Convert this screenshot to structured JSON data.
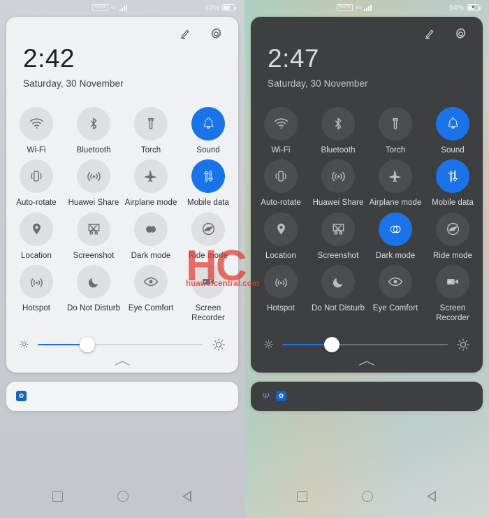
{
  "watermark": {
    "logo": "HC",
    "url": "huaweicentral.com"
  },
  "panels": [
    {
      "theme": "light",
      "status": {
        "volte": "VoLTE",
        "network": "4G",
        "signal_icon": "signal-bars-icon",
        "battery_percent": "63%",
        "battery_level": 63,
        "charging": false
      },
      "header": {
        "edit_icon": "pencil-edit-icon",
        "settings_icon": "gear-icon"
      },
      "clock": "2:42",
      "date": "Saturday, 30 November",
      "tiles": [
        {
          "label": "Wi-Fi",
          "icon": "wifi-icon",
          "active": false
        },
        {
          "label": "Bluetooth",
          "icon": "bluetooth-icon",
          "active": false
        },
        {
          "label": "Torch",
          "icon": "flashlight-icon",
          "active": false
        },
        {
          "label": "Sound",
          "icon": "bell-icon",
          "active": true
        },
        {
          "label": "Auto-rotate",
          "icon": "rotate-screen-icon",
          "active": false
        },
        {
          "label": "Huawei Share",
          "icon": "broadcast-icon",
          "active": false
        },
        {
          "label": "Airplane mode",
          "icon": "airplane-icon",
          "active": false
        },
        {
          "label": "Mobile data",
          "icon": "data-arrows-icon",
          "active": true
        },
        {
          "label": "Location",
          "icon": "location-pin-icon",
          "active": false
        },
        {
          "label": "Screenshot",
          "icon": "scissors-crop-icon",
          "active": false
        },
        {
          "label": "Dark mode",
          "icon": "contrast-circles-icon",
          "active": false
        },
        {
          "label": "Ride mode",
          "icon": "helmet-icon",
          "active": false
        },
        {
          "label": "Hotspot",
          "icon": "hotspot-icon",
          "active": false
        },
        {
          "label": "Do Not Disturb",
          "icon": "moon-icon",
          "active": false
        },
        {
          "label": "Eye Comfort",
          "icon": "eye-icon",
          "active": false
        },
        {
          "label": "Screen Recorder",
          "icon": "video-camera-icon",
          "active": false
        }
      ],
      "brightness": {
        "low_icon": "sun-small-icon",
        "high_icon": "sun-large-icon",
        "value_percent": 30
      },
      "collapse_icon": "chevron-up-icon",
      "notifications": [
        {
          "icon": "app-icon",
          "glyph": "✿"
        }
      ],
      "navbar": {
        "recents_icon": "square-recents-icon",
        "home_icon": "circle-home-icon",
        "back_icon": "triangle-back-icon"
      }
    },
    {
      "theme": "dark",
      "status": {
        "volte": "VoLTE",
        "network": "4G",
        "signal_icon": "signal-bars-icon",
        "battery_percent": "64%",
        "battery_level": 64,
        "charging": true
      },
      "header": {
        "edit_icon": "pencil-edit-icon",
        "settings_icon": "gear-icon"
      },
      "clock": "2:47",
      "date": "Saturday, 30 November",
      "tiles": [
        {
          "label": "Wi-Fi",
          "icon": "wifi-icon",
          "active": false
        },
        {
          "label": "Bluetooth",
          "icon": "bluetooth-icon",
          "active": false
        },
        {
          "label": "Torch",
          "icon": "flashlight-icon",
          "active": false
        },
        {
          "label": "Sound",
          "icon": "bell-icon",
          "active": true
        },
        {
          "label": "Auto-rotate",
          "icon": "rotate-screen-icon",
          "active": false
        },
        {
          "label": "Huawei Share",
          "icon": "broadcast-icon",
          "active": false
        },
        {
          "label": "Airplane mode",
          "icon": "airplane-icon",
          "active": false
        },
        {
          "label": "Mobile data",
          "icon": "data-arrows-icon",
          "active": true
        },
        {
          "label": "Location",
          "icon": "location-pin-icon",
          "active": false
        },
        {
          "label": "Screenshot",
          "icon": "scissors-crop-icon",
          "active": false
        },
        {
          "label": "Dark mode",
          "icon": "contrast-circles-icon",
          "active": true
        },
        {
          "label": "Ride mode",
          "icon": "helmet-icon",
          "active": false
        },
        {
          "label": "Hotspot",
          "icon": "hotspot-icon",
          "active": false
        },
        {
          "label": "Do Not Disturb",
          "icon": "moon-icon",
          "active": false
        },
        {
          "label": "Eye Comfort",
          "icon": "eye-icon",
          "active": false
        },
        {
          "label": "Screen Recorder",
          "icon": "video-camera-icon",
          "active": false
        }
      ],
      "brightness": {
        "low_icon": "sun-small-icon",
        "high_icon": "sun-large-icon",
        "value_percent": 30
      },
      "collapse_icon": "chevron-up-icon",
      "notifications": [
        {
          "icon": "usb-icon",
          "glyph": "Ψ"
        },
        {
          "icon": "app-icon",
          "glyph": "✿"
        }
      ],
      "navbar": {
        "recents_icon": "square-recents-icon",
        "home_icon": "circle-home-icon",
        "back_icon": "triangle-back-icon"
      }
    }
  ]
}
